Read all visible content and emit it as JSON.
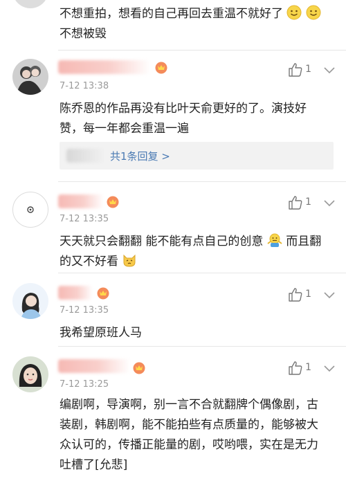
{
  "comments": [
    {
      "text_line1": "不想重拍，想看的自己再回去重温不就好了",
      "text_line2": "不想被毁"
    },
    {
      "time": "7-12 13:38",
      "likes": "1",
      "text_line1": "陈乔恩的作品再没有比叶天俞更好的了。演技好",
      "text_line2": "赞，每一年都会重温一遍",
      "reply_link": "共1条回复 >"
    },
    {
      "time": "7-12 13:35",
      "likes": "1",
      "text_line1": "天天就只会翻翻 能不能有点自己的创意",
      "text_line1b": "而且翻",
      "text_line2": "的又不好看"
    },
    {
      "time": "7-12 13:35",
      "likes": "1",
      "text_line1": "我希望原班人马"
    },
    {
      "time": "7-12 13:25",
      "likes": "1",
      "text_line1": "编剧啊，导演啊，别一言不合就翻牌个偶像剧，古",
      "text_line2": "装剧，韩剧啊，能不能拍些有点质量的，能够被大",
      "text_line3": "众认可的，传播正能量的剧，哎哟喂，实在是无力",
      "text_line4": "吐槽了[允悲]"
    }
  ],
  "icons": {
    "like": "thumbs-up-icon",
    "more": "chevron-down-icon",
    "vip": "vip-crown-icon",
    "emoji_smile": "smile-emoji",
    "emoji_shrug": "shrug-emoji",
    "emoji_cat": "cat-emoji"
  },
  "colors": {
    "link": "#4a7ab3",
    "time": "#9a9a9a",
    "name_redacted": "#f6b9b4"
  }
}
